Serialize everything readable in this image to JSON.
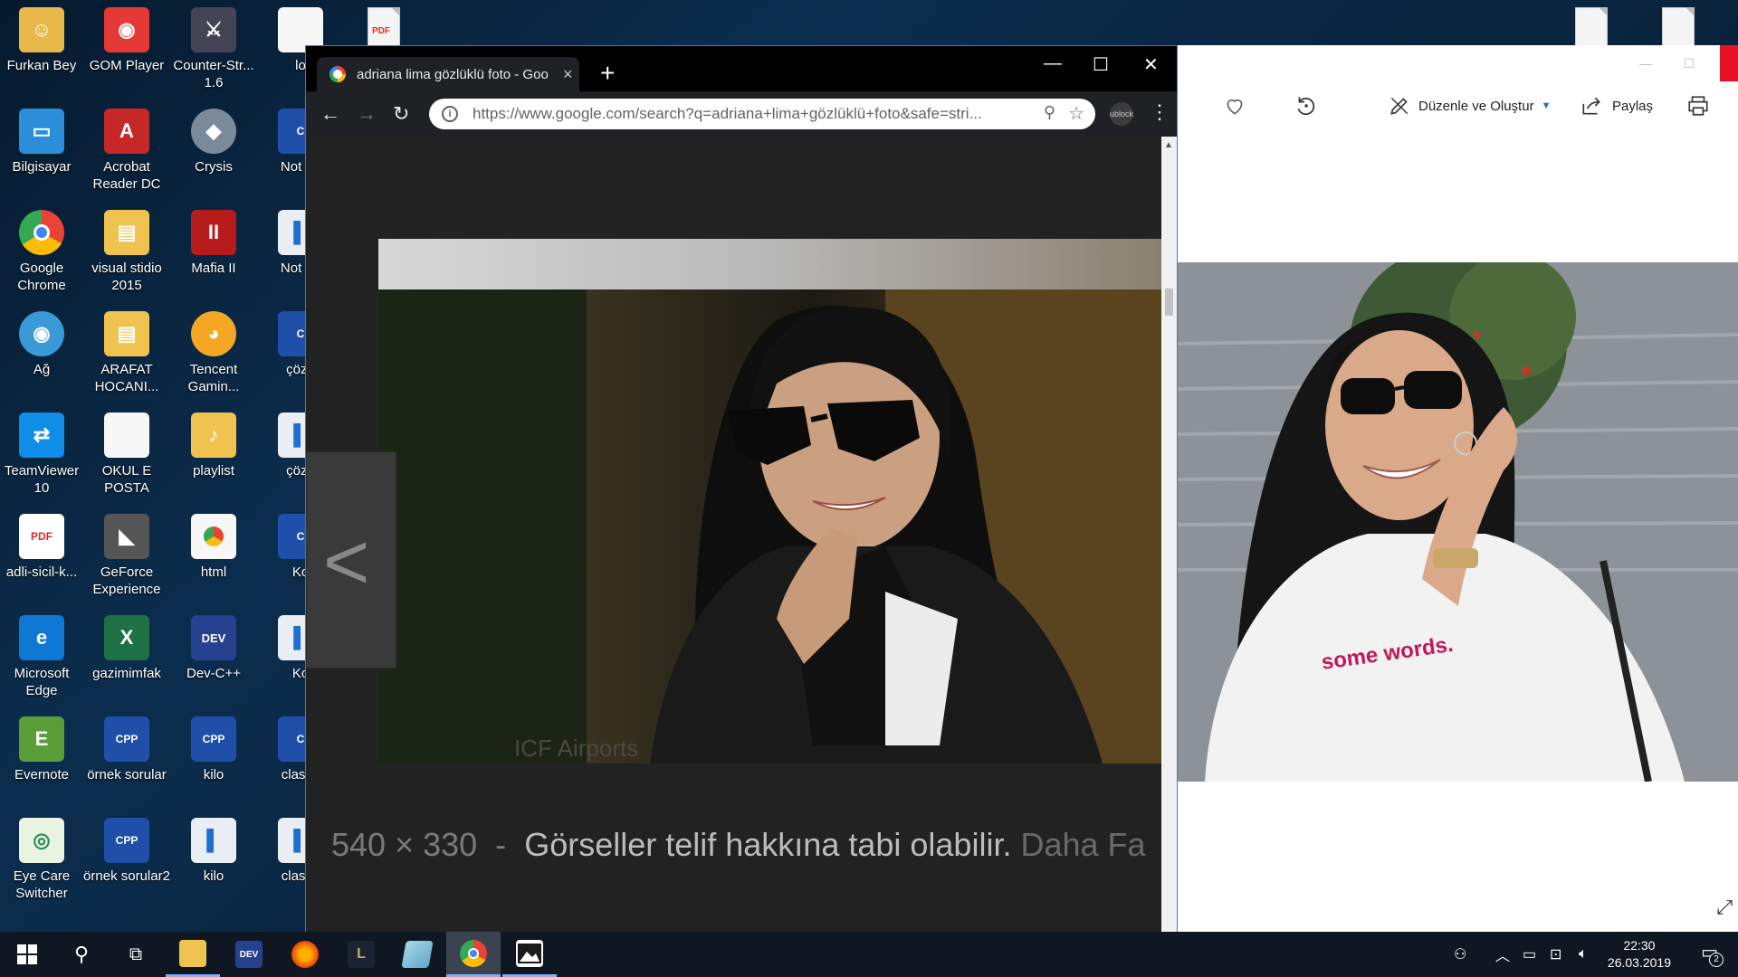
{
  "desktop": {
    "icons": [
      {
        "label": "Furkan Bey"
      },
      {
        "label": "GOM Player"
      },
      {
        "label": "Counter-Str... 1.6"
      },
      {
        "label": "lo"
      },
      {
        "label": "Bilgisayar"
      },
      {
        "label": "Acrobat Reader DC"
      },
      {
        "label": "Crysis"
      },
      {
        "label": "Not po"
      },
      {
        "label": "Google Chrome"
      },
      {
        "label": "visual stidio 2015"
      },
      {
        "label": "Mafia II"
      },
      {
        "label": "Not po"
      },
      {
        "label": "Ağ"
      },
      {
        "label": "ARAFAT HOCANI..."
      },
      {
        "label": "Tencent Gamin..."
      },
      {
        "label": "çözü"
      },
      {
        "label": "TeamViewer 10"
      },
      {
        "label": "OKUL E POSTA"
      },
      {
        "label": "playlist"
      },
      {
        "label": "çözü"
      },
      {
        "label": "adli-sicil-k..."
      },
      {
        "label": "GeForce Experience"
      },
      {
        "label": "html"
      },
      {
        "label": "Ko"
      },
      {
        "label": "Microsoft Edge"
      },
      {
        "label": "gazimimfak"
      },
      {
        "label": "Dev-C++"
      },
      {
        "label": "Ko"
      },
      {
        "label": "Evernote"
      },
      {
        "label": "örnek sorular"
      },
      {
        "label": "kilo"
      },
      {
        "label": "classo"
      },
      {
        "label": "Eye Care Switcher"
      },
      {
        "label": "örnek sorular2"
      },
      {
        "label": "kilo"
      },
      {
        "label": "classo"
      }
    ]
  },
  "chrome": {
    "tab_title": "adriana lima gözlüklü foto - Goo",
    "tab_close": "×",
    "new_tab": "+",
    "url": "https://www.google.com/search?q=adriana+lima+gözlüklü+foto&safe=stri...",
    "ext_label": "ublock",
    "caption": {
      "dims": "540 × 330",
      "separator": "-",
      "notice": "Görseller telif hakkına tabi olabilir.",
      "more": "Daha Fa"
    },
    "watermark": "ICF Airports"
  },
  "photos": {
    "toolbar": {
      "edit_label": "Düzenle ve Oluştur",
      "share_label": "Paylaş"
    },
    "shirt_text": "some    words."
  },
  "taskbar": {
    "time": "22:30",
    "date": "26.03.2019",
    "notification_count": "2"
  },
  "colors": {
    "chrome_dark": "#202124",
    "accent": "#3a7bd5",
    "close_red": "#e81123"
  }
}
